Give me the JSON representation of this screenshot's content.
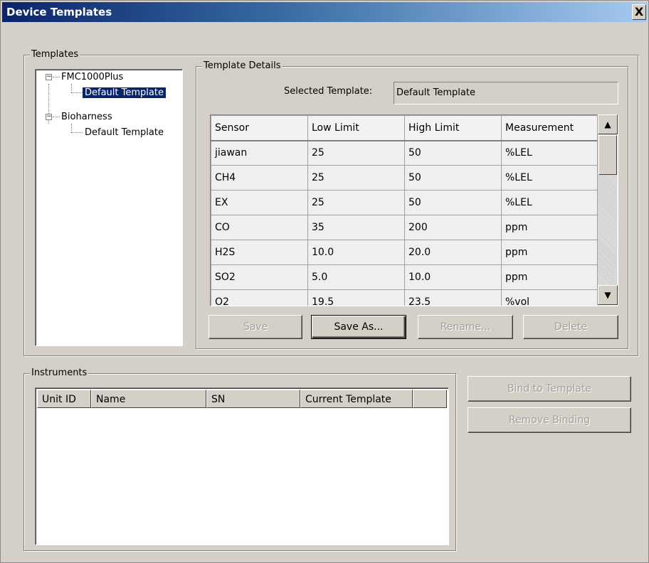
{
  "window": {
    "title": "Device Templates",
    "close_glyph": "X"
  },
  "templates": {
    "group_label": "Templates",
    "tree": [
      {
        "label": "FMC1000Plus",
        "expander": "−",
        "children": [
          {
            "label": "Default Template",
            "selected": true
          }
        ]
      },
      {
        "label": "Bioharness",
        "expander": "−",
        "children": [
          {
            "label": "Default Template",
            "selected": false
          }
        ]
      }
    ]
  },
  "details": {
    "group_label": "Template Details",
    "selected_label": "Selected Template:",
    "selected_value": "Default Template",
    "columns": [
      "Sensor",
      "Low Limit",
      "High Limit",
      "Measurement"
    ],
    "rows": [
      [
        "jiawan",
        "25",
        "50",
        "%LEL"
      ],
      [
        "CH4",
        "25",
        "50",
        "%LEL"
      ],
      [
        "EX",
        "25",
        "50",
        "%LEL"
      ],
      [
        "CO",
        "35",
        "200",
        "ppm"
      ],
      [
        "H2S",
        "10.0",
        "20.0",
        "ppm"
      ],
      [
        "SO2",
        "5.0",
        "10.0",
        "ppm"
      ],
      [
        "O2",
        "19.5",
        "23.5",
        "%vol"
      ]
    ],
    "buttons": {
      "save": "Save",
      "save_as": "Save As...",
      "rename": "Rename...",
      "delete": "Delete"
    }
  },
  "instruments": {
    "group_label": "Instruments",
    "columns": [
      "Unit ID",
      "Name",
      "SN",
      "Current Template"
    ],
    "bind_button": "Bind to Template",
    "remove_button": "Remove Binding"
  },
  "scroll": {
    "up_glyph": "▲",
    "down_glyph": "▼"
  }
}
